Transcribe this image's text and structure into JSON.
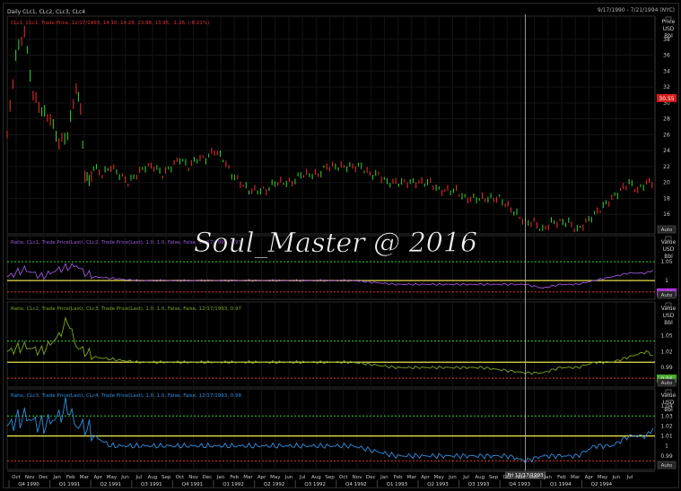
{
  "header": {
    "title": "Daily CLc1, CLc2, CLc3, CLc4",
    "date_range": "9/17/1990 - 7/21/1994 (NYC)"
  },
  "panels": [
    {
      "id": "price",
      "legend": "CLc1, CLc1, Trade Price, 12/17/1993, 14.10, 14.28, 13.88, 13.95, -1.26, (-8.21%)",
      "legend_color": "#e03030",
      "axis_title": [
        "Price",
        "USD",
        "Bbl"
      ],
      "ticks": [
        "38",
        "36",
        "34",
        "32",
        "30",
        "28",
        "26",
        "24",
        "22",
        "20",
        "18",
        "16"
      ],
      "current_tag": "30.55",
      "tag_color": "#d81a1a"
    },
    {
      "id": "ratio1",
      "legend": "Ratio, CLc1, Trade Price(Last), CLc2, Trade Price(Last), 1.0, 1.0, False, False, 12/17/1993, 0.97",
      "legend_color": "#9b54d8",
      "axis_title": [
        "Value",
        "USD",
        "Bbl"
      ],
      "ticks": [
        "1.05",
        "1"
      ],
      "current_tag": "0.97",
      "tag_color": "#b030e0"
    },
    {
      "id": "ratio2",
      "legend": "Ratio, CLc2, Trade Price(Last), CLc3, Trade Price(Last), 1.0, 1.0, False, False, 12/17/1993, 0.97",
      "legend_color": "#7ea820",
      "axis_title": [
        "Value",
        "USD",
        "Bbl"
      ],
      "ticks": [
        "1.05",
        "1.02",
        "0.99"
      ],
      "current_tag": "0.96",
      "tag_color": "#4caf2c"
    },
    {
      "id": "ratio3",
      "legend": "Ratio, CLc3, Trade Price(Last), CLc4, Trade Price(Last), 1.0, 1.0, False, False, 12/17/1993, 0.98",
      "legend_color": "#2f8fe0",
      "axis_title": [
        "Value",
        "USD",
        "Bbl"
      ],
      "ticks": [
        "1.04",
        "1.03",
        "1.02",
        "1.01",
        "1",
        "0.99"
      ],
      "current_tag": "",
      "tag_color": "#2f8fe0"
    }
  ],
  "axis_buttons": [
    "Auto",
    "Auto",
    "Auto",
    "Auto"
  ],
  "watermark": "Soul_Master @ 2016",
  "crosshair_label": "Fri 12/17/1993",
  "months": [
    "Oct",
    "Nov",
    "Dec",
    "Jan",
    "Feb",
    "Mar",
    "Apr",
    "May",
    "Jun",
    "Jul",
    "Aug",
    "Sep",
    "Oct",
    "Nov",
    "Dec",
    "Jan",
    "Feb",
    "Mar",
    "Apr",
    "May",
    "Jun",
    "Jul",
    "Aug",
    "Sep",
    "Oct",
    "Nov",
    "Dec",
    "Jan",
    "Feb",
    "Mar",
    "Apr",
    "May",
    "Jun",
    "Jul",
    "Aug",
    "Sep",
    "Oct",
    "Nov",
    "Dec",
    "Jan",
    "Feb",
    "Mar",
    "Apr",
    "May",
    "Jun",
    "Jul"
  ],
  "quarters": [
    "Q4 1990",
    "Q1 1991",
    "Q2 1991",
    "Q3 1991",
    "Q4 1991",
    "Q1 1992",
    "Q2 1992",
    "Q3 1992",
    "Q4 1992",
    "Q1 1993",
    "Q2 1993",
    "Q3 1993",
    "Q4 1993",
    "Q1 1994",
    "Q2 1994"
  ],
  "chart_data": {
    "type": "line",
    "price_series": {
      "ylim": [
        14,
        40
      ],
      "points": [
        [
          0,
          26
        ],
        [
          2,
          36
        ],
        [
          4,
          39
        ],
        [
          6,
          31
        ],
        [
          8,
          29
        ],
        [
          10,
          28
        ],
        [
          12,
          25
        ],
        [
          14,
          26
        ],
        [
          16,
          32
        ],
        [
          17,
          29
        ],
        [
          18,
          21
        ],
        [
          19,
          20
        ],
        [
          20,
          22
        ],
        [
          22,
          21
        ],
        [
          24,
          22
        ],
        [
          26,
          21
        ],
        [
          28,
          20
        ],
        [
          30,
          21
        ],
        [
          32,
          22
        ],
        [
          34,
          22
        ],
        [
          36,
          21
        ],
        [
          38,
          22
        ],
        [
          40,
          23
        ],
        [
          42,
          22
        ],
        [
          44,
          23
        ],
        [
          46,
          23
        ],
        [
          48,
          24
        ],
        [
          50,
          23
        ],
        [
          52,
          21
        ],
        [
          54,
          20
        ],
        [
          56,
          19
        ],
        [
          58,
          19
        ],
        [
          60,
          19
        ],
        [
          62,
          20
        ],
        [
          64,
          20
        ],
        [
          66,
          20
        ],
        [
          68,
          21
        ],
        [
          70,
          21
        ],
        [
          72,
          21
        ],
        [
          74,
          22
        ],
        [
          76,
          22
        ],
        [
          78,
          22
        ],
        [
          80,
          22
        ],
        [
          82,
          22
        ],
        [
          84,
          21
        ],
        [
          86,
          21
        ],
        [
          88,
          20
        ],
        [
          90,
          20
        ],
        [
          92,
          20
        ],
        [
          94,
          20
        ],
        [
          96,
          20
        ],
        [
          98,
          20
        ],
        [
          100,
          19
        ],
        [
          102,
          19
        ],
        [
          104,
          19
        ],
        [
          106,
          18
        ],
        [
          108,
          18
        ],
        [
          110,
          18
        ],
        [
          112,
          18
        ],
        [
          114,
          18
        ],
        [
          116,
          17
        ],
        [
          118,
          16
        ],
        [
          120,
          15
        ],
        [
          122,
          15
        ],
        [
          124,
          14
        ],
        [
          126,
          15
        ],
        [
          128,
          15
        ],
        [
          130,
          15
        ],
        [
          132,
          14
        ],
        [
          134,
          15
        ],
        [
          136,
          16
        ],
        [
          138,
          17
        ],
        [
          140,
          18
        ],
        [
          142,
          19
        ],
        [
          144,
          20
        ],
        [
          146,
          19
        ],
        [
          148,
          20
        ],
        [
          150,
          20
        ]
      ]
    },
    "ratio_series": [
      {
        "name": "CLc1/CLc2",
        "ylim": [
          0.96,
          1.1
        ],
        "upper": 1.05,
        "mid": 1.0,
        "lower": 0.97,
        "points": [
          [
            0,
            1.01
          ],
          [
            4,
            1.03
          ],
          [
            8,
            1.01
          ],
          [
            12,
            1.03
          ],
          [
            16,
            1.04
          ],
          [
            18,
            1.02
          ],
          [
            20,
            1.01
          ],
          [
            30,
            1.0
          ],
          [
            40,
            1.0
          ],
          [
            50,
            1.0
          ],
          [
            60,
            1.0
          ],
          [
            70,
            1.0
          ],
          [
            80,
            1.0
          ],
          [
            90,
            0.99
          ],
          [
            100,
            0.99
          ],
          [
            110,
            0.99
          ],
          [
            120,
            0.99
          ],
          [
            124,
            0.98
          ],
          [
            128,
            0.99
          ],
          [
            132,
            0.99
          ],
          [
            136,
            1.0
          ],
          [
            140,
            1.01
          ],
          [
            144,
            1.02
          ],
          [
            148,
            1.02
          ],
          [
            150,
            1.03
          ]
        ]
      },
      {
        "name": "CLc2/CLc3",
        "ylim": [
          0.96,
          1.1
        ],
        "upper": 1.04,
        "mid": 1.0,
        "lower": 0.97,
        "points": [
          [
            0,
            1.02
          ],
          [
            4,
            1.03
          ],
          [
            8,
            1.02
          ],
          [
            12,
            1.05
          ],
          [
            14,
            1.08
          ],
          [
            16,
            1.03
          ],
          [
            18,
            1.02
          ],
          [
            20,
            1.01
          ],
          [
            30,
            1.0
          ],
          [
            40,
            1.0
          ],
          [
            50,
            1.0
          ],
          [
            60,
            1.0
          ],
          [
            70,
            1.0
          ],
          [
            80,
            1.0
          ],
          [
            90,
            0.99
          ],
          [
            100,
            0.99
          ],
          [
            110,
            0.99
          ],
          [
            120,
            0.98
          ],
          [
            124,
            0.98
          ],
          [
            128,
            0.99
          ],
          [
            132,
            0.99
          ],
          [
            136,
            1.0
          ],
          [
            140,
            1.0
          ],
          [
            144,
            1.01
          ],
          [
            148,
            1.02
          ],
          [
            150,
            1.01
          ]
        ]
      },
      {
        "name": "CLc3/CLc4",
        "ylim": [
          0.98,
          1.05
        ],
        "upper": 1.03,
        "mid": 1.01,
        "lower": 0.985,
        "points": [
          [
            0,
            1.02
          ],
          [
            4,
            1.03
          ],
          [
            8,
            1.02
          ],
          [
            12,
            1.03
          ],
          [
            14,
            1.04
          ],
          [
            16,
            1.02
          ],
          [
            18,
            1.02
          ],
          [
            20,
            1.01
          ],
          [
            24,
            1.0
          ],
          [
            30,
            1.0
          ],
          [
            40,
            1.0
          ],
          [
            50,
            1.0
          ],
          [
            60,
            1.0
          ],
          [
            70,
            1.0
          ],
          [
            80,
            1.0
          ],
          [
            90,
            0.99
          ],
          [
            100,
            0.99
          ],
          [
            110,
            0.99
          ],
          [
            116,
            0.99
          ],
          [
            120,
            0.985
          ],
          [
            124,
            0.99
          ],
          [
            128,
            0.99
          ],
          [
            132,
            0.99
          ],
          [
            136,
            1.0
          ],
          [
            140,
            1.0
          ],
          [
            144,
            1.01
          ],
          [
            148,
            1.01
          ],
          [
            150,
            1.02
          ]
        ]
      }
    ],
    "crosshair_index": 120
  }
}
